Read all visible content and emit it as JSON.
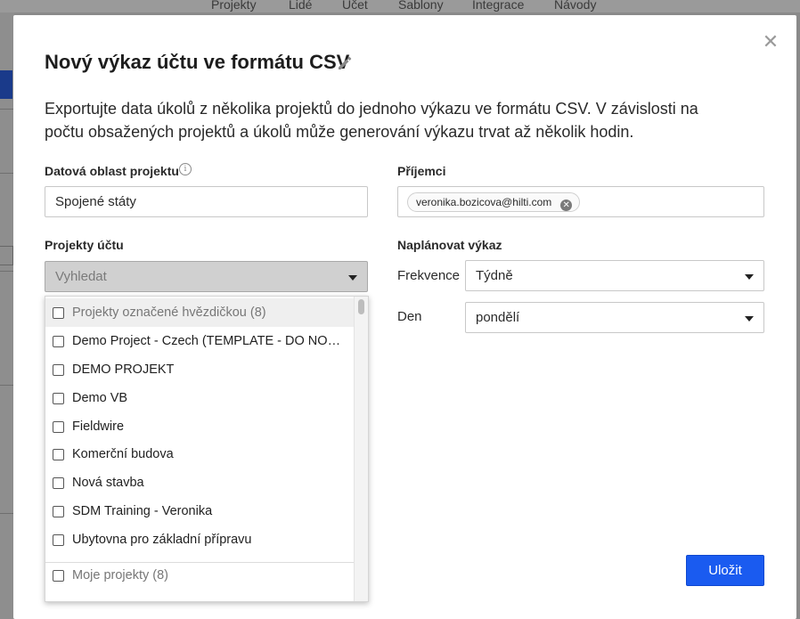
{
  "background": {
    "nav": [
      "Projekty",
      "Lidé",
      "Účet",
      "Šablony",
      "Integrace",
      "Návody"
    ]
  },
  "modal": {
    "title": "Nový výkaz účtu ve formátu CSV",
    "description": "Exportujte data úkolů z několika projektů do jednoho výkazu ve formátu CSV. V závislosti na počtu obsažených projektů a úkolů může generování výkazu trvat až několik hodin.",
    "data_region": {
      "label": "Datová oblast projektu",
      "value": "Spojené státy"
    },
    "recipients": {
      "label": "Příjemci",
      "chips": [
        "veronika.bozicova@hilti.com"
      ]
    },
    "account_projects": {
      "label": "Projekty účtu",
      "placeholder": "Vyhledat",
      "items": [
        {
          "label": "Projekty označené hvězdičkou (8)",
          "group": true
        },
        {
          "label": "Demo Project - Czech (TEMPLATE - DO NOT MODIFY)"
        },
        {
          "label": "DEMO PROJEKT"
        },
        {
          "label": "Demo VB"
        },
        {
          "label": "Fieldwire"
        },
        {
          "label": "Komerční budova"
        },
        {
          "label": "Nová stavba"
        },
        {
          "label": "SDM Training - Veronika"
        },
        {
          "label": "Ubytovna pro základní přípravu"
        },
        {
          "label": "Moje projekty (8)",
          "group": true
        }
      ]
    },
    "schedule": {
      "label": "Naplánovat výkaz",
      "frequency_label": "Frekvence",
      "frequency_value": "Týdně",
      "day_label": "Den",
      "day_value": "pondělí"
    },
    "save_label": "Uložit"
  },
  "colors": {
    "primary": "#1a5bf0",
    "overlay": "#8a8a8a"
  }
}
